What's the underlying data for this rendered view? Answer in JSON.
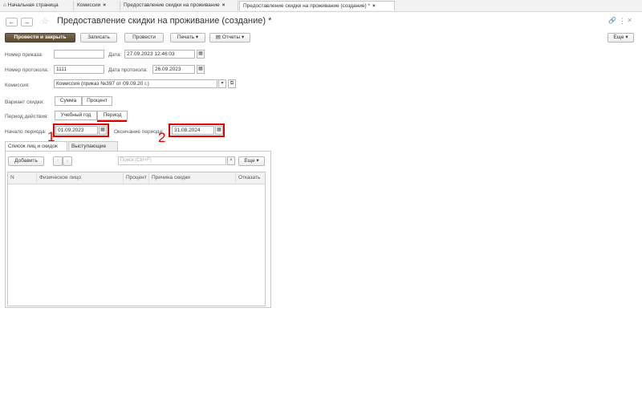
{
  "tabs": [
    {
      "label": "Начальная страница",
      "closable": false
    },
    {
      "label": "Комиссии",
      "closable": true
    },
    {
      "label": "Предоставление скидки на проживание",
      "closable": true
    },
    {
      "label": "Предоставление скидки на проживание (создание) *",
      "closable": true,
      "active": true
    }
  ],
  "close_glyph": "×",
  "home_glyph": "⌂",
  "header": {
    "title": "Предоставление скидки на проживание (создание) *",
    "back": "←",
    "forward": "→",
    "star": "☆",
    "link_icon": "🔗",
    "more_icon": "⋮",
    "close_icon": "×"
  },
  "toolbar": {
    "post_close": "Провести и закрыть",
    "save": "Записать",
    "post": "Провести",
    "print": "Печать ▾",
    "reports": "Отчеты ▾",
    "more": "Еще ▾"
  },
  "form": {
    "order_number_label": "Номер приказа:",
    "order_number_value": "",
    "date_label": "Дата:",
    "date_value": "27.09.2023 12:46:03",
    "protocol_number_label": "Номер протокола:",
    "protocol_number_value": "1111",
    "protocol_date_label": "Дата протокола:",
    "protocol_date_value": "26.09.2023",
    "commission_label": "Комиссия:",
    "commission_value": "Комиссия (приказ №397 от 09.09.20 г.)",
    "discount_variant_label": "Вариант скидки:",
    "discount_variant_options": [
      "Сумма",
      "Процент"
    ],
    "action_period_label": "Период действия:",
    "action_period_options": [
      "Учебный год",
      "Период"
    ],
    "period_start_label": "Начало периода:",
    "period_start_value": "01.09.2023",
    "period_end_label": "Окончание периода:",
    "period_end_value": "31.08.2024",
    "calendar_glyph": "▦",
    "dropdown_glyph": "▾",
    "open_glyph": "⧉"
  },
  "annotations": {
    "one": "1",
    "two": "2"
  },
  "subtabs": [
    "Список лиц и скидок",
    "Выступающие"
  ],
  "list": {
    "add_button": "Добавить",
    "up": "↑",
    "down": "↓",
    "search_placeholder": "Поиск (Ctrl+F)",
    "search_clear": "×",
    "more": "Еще ▾",
    "columns": [
      "N",
      "Физическое лицо",
      "Процент",
      "Причина скидки",
      "Отказать"
    ],
    "rows": []
  }
}
